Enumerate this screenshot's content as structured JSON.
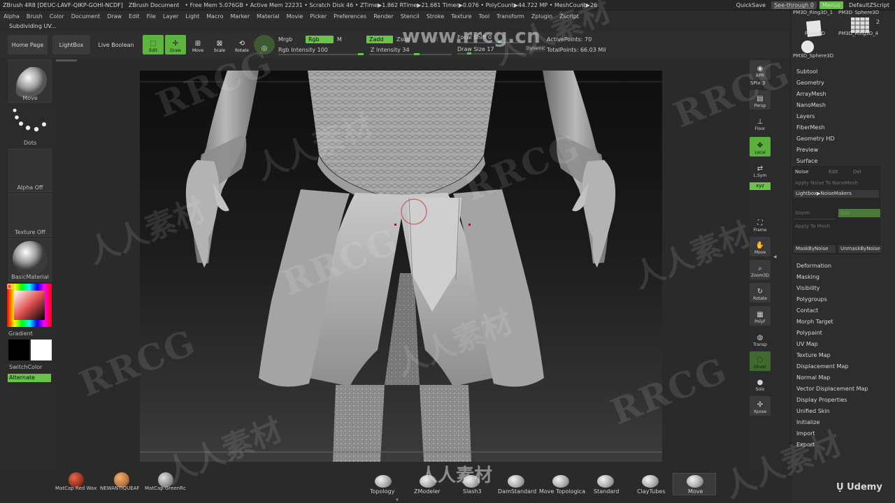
{
  "titlebar": {
    "app": "ZBrush 4R8 [DEUC-LAVF-QIKP-GOHI-NCDF]",
    "doc": "ZBrush Document",
    "stats": "• Free Mem 5.076GB • Active Mem 22231 • Scratch Disk 46 • ZTime▶1.862 RTime▶21.681 Timer▶0.076 • PolyCount▶44.722 MP • MeshCount▶26",
    "quicksave": "QuickSave",
    "see_through": "See-through  0",
    "menus": "Menus",
    "script": "DefaultZScript"
  },
  "menubar": [
    "Alpha",
    "Brush",
    "Color",
    "Document",
    "Draw",
    "Edit",
    "File",
    "Layer",
    "Light",
    "Macro",
    "Marker",
    "Material",
    "Movie",
    "Picker",
    "Preferences",
    "Render",
    "Stencil",
    "Stroke",
    "Texture",
    "Tool",
    "Transform",
    "Zplugin",
    "Zscript"
  ],
  "status": "Subdividing UV...",
  "toolbar": {
    "home": "Home Page",
    "lightbox": "LightBox",
    "liveboolean": "Live Boolean",
    "edit": "Edit",
    "draw": "Draw",
    "move": "Move",
    "scale": "Scale",
    "rotate": "Rotate",
    "mrgb": "Mrgb",
    "rgb": "Rgb",
    "m": "M",
    "rgb_intensity": "Rgb Intensity 100",
    "zadd": "Zadd",
    "zsub": "Zsub",
    "zcut": "Zcut",
    "z_intensity": "Z Intensity 34",
    "focal_shift": "Focal Shift 0",
    "draw_size": "Draw Size 17",
    "dynamic": "Dynamic",
    "active_points": "ActivePoints: 70",
    "total_points": "TotalPoints: 66.03 Mil"
  },
  "leftshelf": {
    "brush": "Move",
    "stroke": "Dots",
    "alpha": "Alpha Off",
    "texture": "Texture Off",
    "material": "BasicMaterial",
    "gradient": "Gradient",
    "switchcolor": "SwitchColor",
    "alternate": "Alternate"
  },
  "rightcol": [
    {
      "label": "BPR",
      "name": "bpr"
    },
    {
      "label": "SPix 3",
      "name": "spix"
    },
    {
      "label": "Persp",
      "name": "persp"
    },
    {
      "label": "Floor",
      "name": "floor"
    },
    {
      "label": "Local",
      "name": "local"
    },
    {
      "label": "L.Sym",
      "name": "lsym"
    },
    {
      "label": "xyz",
      "name": "xyz"
    },
    {
      "label": "Frame",
      "name": "frame"
    },
    {
      "label": "Move",
      "name": "move"
    },
    {
      "label": "Zoom3D",
      "name": "zoom3d"
    },
    {
      "label": "Rotate",
      "name": "rotate"
    },
    {
      "label": "PolyF",
      "name": "polyf"
    },
    {
      "label": "Transp",
      "name": "transp"
    },
    {
      "label": "Ghost",
      "name": "ghost"
    },
    {
      "label": "Solo",
      "name": "solo"
    },
    {
      "label": "Xpose",
      "name": "xpose"
    }
  ],
  "toolpanel": {
    "thumbs": [
      {
        "label": "PM3D_Ring3D_1"
      },
      {
        "label": "PM3D_Sphere3D"
      },
      {
        "label": "Plane3D"
      },
      {
        "label": "PM3D_Ring3D_4"
      },
      {
        "label": "PM3D_Sphere3D"
      }
    ],
    "thumb_count": "2",
    "items_top": [
      "Subtool",
      "Geometry",
      "ArrayMesh",
      "NanoMesh",
      "Layers",
      "FiberMesh",
      "Geometry HD",
      "Preview",
      "Surface"
    ],
    "surface": {
      "noise": "Noise",
      "edit": "Edit",
      "del": "Del",
      "apply_nano": "Apply Noise To NanoMesh",
      "lightbox_noise": "Lightbox▶NoiseMakers",
      "storm": "Storm",
      "sav": "Sav",
      "apply_mesh": "Apply To Mesh",
      "mask": "MaskByNoise",
      "unmask": "UnmaskByNoise"
    },
    "items_bottom": [
      "Deformation",
      "Masking",
      "Visibility",
      "Polygroups",
      "Contact",
      "Morph Target",
      "Polypaint",
      "UV Map",
      "Texture Map",
      "Displacement Map",
      "Normal Map",
      "Vector Displacement Map",
      "Display Properties",
      "Unified Skin",
      "Initialize",
      "Import",
      "Export"
    ]
  },
  "materials": [
    {
      "label": "MatCap Red Wax",
      "color": "#9a2f1f"
    },
    {
      "label": "NEWANTIQUEAF",
      "color": "#b8733a"
    },
    {
      "label": "MatCap GreenRc",
      "color": "#8e8e8e"
    }
  ],
  "brushes": [
    "Topology",
    "ZModeler",
    "Slash3",
    "DamStandard",
    "Move Topologica",
    "Standard",
    "ClayTubes",
    "Move"
  ],
  "watermarks": {
    "rrcg": "RRCG",
    "cn": "人人素材",
    "url": "www.rrcg.cn"
  },
  "udemy": "Udemy",
  "colors": {
    "accent": "#6cc34c",
    "bg": "#2b2b2b"
  }
}
